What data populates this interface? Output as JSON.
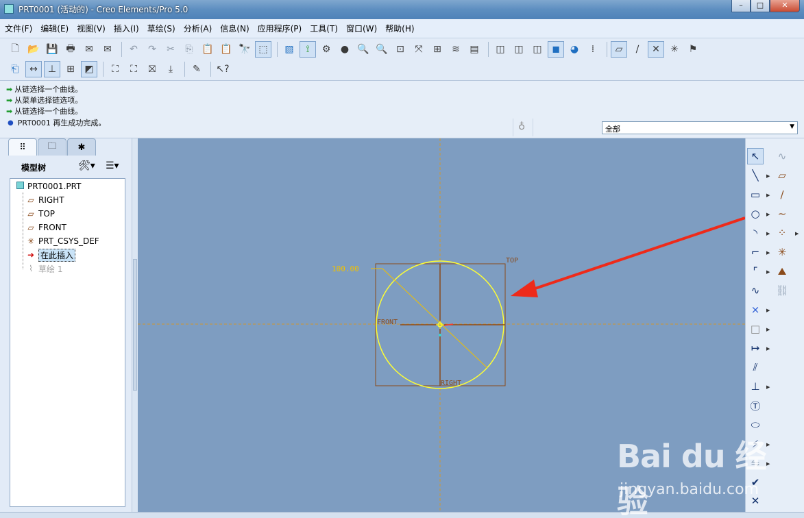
{
  "window": {
    "title": "PRT0001 (活动的) - Creo Elements/Pro 5.0",
    "controls": {
      "minimize": "–",
      "maximize": "□",
      "close": "✕"
    }
  },
  "menu": [
    "文件(F)",
    "编辑(E)",
    "视图(V)",
    "插入(I)",
    "草绘(S)",
    "分析(A)",
    "信息(N)",
    "应用程序(P)",
    "工具(T)",
    "窗口(W)",
    "帮助(H)"
  ],
  "messages": [
    {
      "type": "prompt",
      "text": "从链选择一个曲线。"
    },
    {
      "type": "prompt",
      "text": "从菜单选择链选项。"
    },
    {
      "type": "prompt",
      "text": "从链选择一个曲线。"
    },
    {
      "type": "info",
      "text": "PRT0001 再生成功完成。"
    }
  ],
  "filter": {
    "selected": "全部"
  },
  "model_tree": {
    "title": "模型树",
    "items": [
      {
        "label": "PRT0001.PRT",
        "icon": "part-icon"
      },
      {
        "label": "RIGHT",
        "icon": "datum-plane-icon"
      },
      {
        "label": "TOP",
        "icon": "datum-plane-icon"
      },
      {
        "label": "FRONT",
        "icon": "datum-plane-icon"
      },
      {
        "label": "PRT_CSYS_DEF",
        "icon": "csys-icon"
      },
      {
        "label": "在此插入",
        "icon": "insert-arrow-icon"
      },
      {
        "label": "草绘 1",
        "icon": "sketch-icon"
      }
    ]
  },
  "sketch": {
    "dimension_label": "100.00",
    "plane_labels": {
      "top": "TOP",
      "front": "FRONT",
      "right": "RIGHT"
    },
    "circle_color": "#ffff33",
    "plane_color": "#8a4a1a",
    "dimension_color": "#f0c000",
    "arrow_color": "#ee2a1a"
  },
  "watermark": {
    "brand": "Bai du 经验",
    "url": "jingyan.baidu.com"
  },
  "colors": {
    "graphics_bg": "#7e9dc1",
    "panel_bg": "#e2ebf7"
  }
}
